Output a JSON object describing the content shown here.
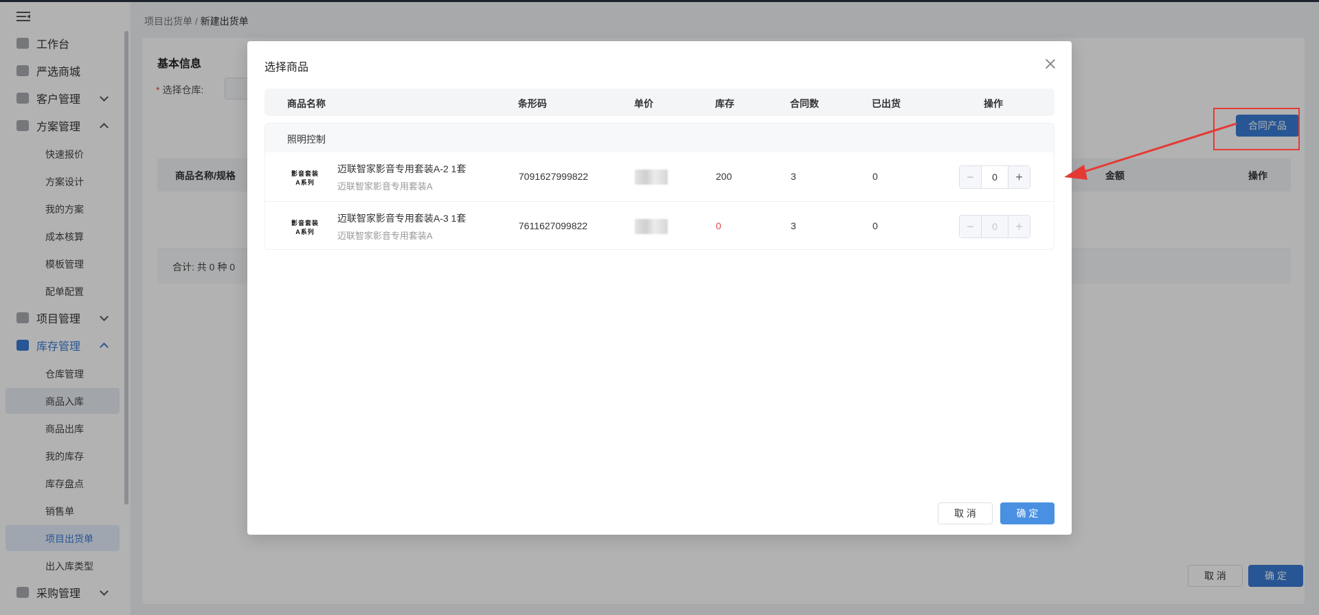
{
  "sidebar": {
    "menu": [
      {
        "label": "工作台",
        "icon": "home-icon"
      },
      {
        "label": "严选商城",
        "icon": "mall-icon"
      },
      {
        "label": "客户管理",
        "icon": "customer-icon"
      },
      {
        "label": "方案管理",
        "icon": "plan-icon"
      },
      {
        "label": "项目管理",
        "icon": "folder-icon"
      },
      {
        "label": "库存管理",
        "icon": "inventory-icon"
      },
      {
        "label": "采购管理",
        "icon": "cart-icon"
      }
    ],
    "plan_sub": [
      "快速报价",
      "方案设计",
      "我的方案",
      "成本核算",
      "模板管理",
      "配单配置"
    ],
    "inventory_sub": [
      "仓库管理",
      "商品入库",
      "商品出库",
      "我的库存",
      "库存盘点",
      "销售单",
      "项目出货单",
      "出入库类型"
    ]
  },
  "breadcrumb": {
    "parent": "项目出货单",
    "separator": "/",
    "current": "新建出货单"
  },
  "form": {
    "section_title": "基本信息",
    "warehouse_label": "选择仓库:",
    "required_mark": "*",
    "contract_button": "合同产品",
    "table_headers": {
      "name": "商品名称/规格",
      "amount": "金额",
      "action": "操作"
    },
    "total_text": "合计: 共 0 种 0",
    "cancel": "取 消",
    "confirm": "确 定"
  },
  "modal": {
    "title": "选择商品",
    "columns": {
      "name": "商品名称",
      "barcode": "条形码",
      "price": "单价",
      "stock": "库存",
      "contract_qty": "合同数",
      "shipped": "已出货",
      "action": "操作"
    },
    "group_name": "照明控制",
    "rows": [
      {
        "thumb_line1": "影音套装",
        "thumb_line2": "A系列",
        "name": "迈联智家影音专用套装A-2 1套",
        "spec": "迈联智家影音专用套装A",
        "barcode": "7091627999822",
        "stock": "200",
        "contract_qty": "3",
        "shipped": "0",
        "qty": "0",
        "disabled": false
      },
      {
        "thumb_line1": "影音套装",
        "thumb_line2": "A系列",
        "name": "迈联智家影音专用套装A-3 1套",
        "spec": "迈联智家影音专用套装A",
        "barcode": "7611627099822",
        "stock": "0",
        "contract_qty": "3",
        "shipped": "0",
        "qty": "0",
        "disabled": true
      }
    ],
    "cancel": "取 消",
    "confirm": "确 定"
  },
  "colors": {
    "primary": "#3a7bd5",
    "danger": "#e54545",
    "annotation": "#e53935"
  }
}
